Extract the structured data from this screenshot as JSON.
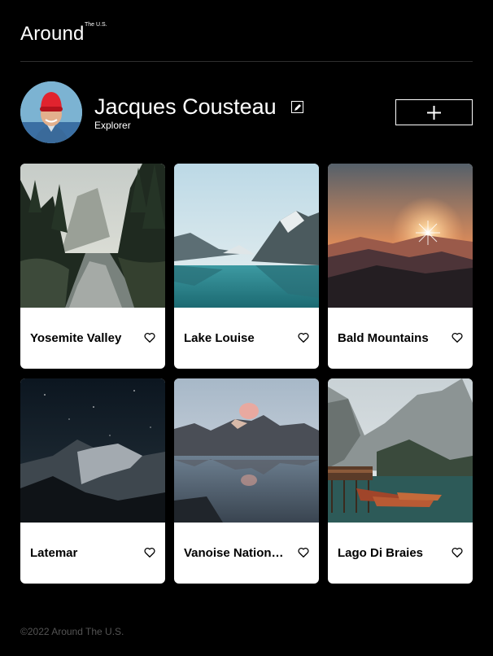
{
  "header": {
    "logo": "Around",
    "logo_sup": "The U.S."
  },
  "profile": {
    "name": "Jacques Cousteau",
    "role": "Explorer",
    "add_label": "+"
  },
  "cards": [
    {
      "title": "Yosemite Valley",
      "photo": "river-forest-photo"
    },
    {
      "title": "Lake Louise",
      "photo": "mountain-lake-photo"
    },
    {
      "title": "Bald Mountains",
      "photo": "sunset-mountains-photo"
    },
    {
      "title": "Latemar",
      "photo": "night-mountain-photo"
    },
    {
      "title": "Vanoise National Park",
      "photo": "alpine-lake-reflection-photo"
    },
    {
      "title": "Lago Di Braies",
      "photo": "lake-boats-photo"
    }
  ],
  "footer": {
    "copyright": "©2022 Around The U.S."
  },
  "colors": {
    "background": "#000000",
    "card": "#ffffff",
    "footer_text": "#545454"
  }
}
